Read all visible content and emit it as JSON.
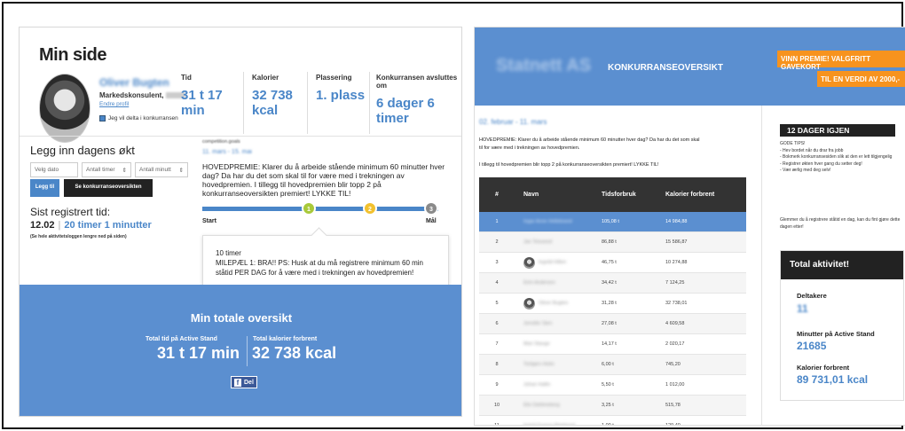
{
  "left": {
    "title": "Min side",
    "profile": {
      "name": "Oliver Bugten",
      "role": "Markedskonsulent,",
      "edit": "Endre profil",
      "join": "Jeg vil delta i konkurransen"
    },
    "stats": [
      {
        "label": "Tid",
        "value": "31 t 17 min"
      },
      {
        "label": "Kalorier",
        "value": "32 738 kcal"
      },
      {
        "label": "Plassering",
        "value": "1. plass"
      },
      {
        "label": "Konkurransen avsluttes om",
        "value": "6 dager 6 timer"
      }
    ],
    "log": {
      "title": "Legg inn dagens økt",
      "date_placeholder": "Velg dato",
      "hours_placeholder": "Antall timer",
      "minutes_placeholder": "Antall minutt",
      "add": "Legg til",
      "overview": "Se konkurranseoversikten"
    },
    "last": {
      "label": "Sist registrert tid:",
      "date": "12.02",
      "duration": "20 timer 1 minutter",
      "note": "(Se hele aktivitetsloggen lengre ned på siden)"
    },
    "competition": {
      "label": "competition.goals",
      "dates": "11. mars - 15. mai",
      "prize": "HOVEDPREMIE: Klarer du å arbeide stående minimum 60 minutter hver dag? Da har du det som skal til for være med i trekningen av hovedpremien. I tillegg til hovedpremien blir topp 2 på konkurranseoversikten premiert! LYKKE TIL!",
      "milestones": [
        "1",
        "2",
        "3"
      ],
      "start": "Start",
      "end": "Mål",
      "progress": 0.45
    },
    "tip": {
      "hours": "10 timer",
      "text": "MILEPÆL 1: BRA!! PS: Husk at du må registrere minimum 60 min ståtid PER DAG for å være med i trekningen av hovedpremien!"
    },
    "overview": {
      "title": "Min totale oversikt",
      "time_label": "Total tid på Active Stand",
      "time_value": "31 t 17 min",
      "kcal_label": "Total kalorier forbrent",
      "kcal_value": "32 738 kcal",
      "share": "Del"
    }
  },
  "right": {
    "logo": "Statnett AS",
    "heading": "KONKURRANSEOVERSIKT",
    "promo1": "VINN PREMIE! VALGFRITT GAVEKORT",
    "promo2": "TIL EN VERDI AV 2000,-",
    "dates": "02. februar - 11. mars",
    "prize": "HOVEDPREMIE: Klarer du å arbeide stående minimum 60 minutter hver dag? Da har du det som skal til for være med i trekningen av hovedpremien.",
    "bonus": "I tillegg til hovedpremien blir topp 2 på konkurranseoversikten premiert! LYKKE TIL!",
    "table": {
      "headers": [
        "#",
        "Navn",
        "Tidsforbruk",
        "Kalorier forbrent"
      ],
      "rows": [
        {
          "rank": "1",
          "name": "Ingar Anne Hellebrand",
          "time": "105,08 t",
          "kcal": "14 984,88"
        },
        {
          "rank": "2",
          "name": "Jan Teisseod",
          "time": "86,88 t",
          "kcal": "15 586,87"
        },
        {
          "rank": "3",
          "name": "Ingvild Hillen",
          "time": "46,75 t",
          "kcal": "10 274,88"
        },
        {
          "rank": "4",
          "name": "Eirin Andersen",
          "time": "34,42 t",
          "kcal": "7 124,25"
        },
        {
          "rank": "5",
          "name": "Oliver Bugten",
          "time": "31,28 t",
          "kcal": "32 738,01"
        },
        {
          "rank": "6",
          "name": "Jennifer Sten",
          "time": "27,08 t",
          "kcal": "4 609,58"
        },
        {
          "rank": "7",
          "name": "Mari Stange",
          "time": "14,17 t",
          "kcal": "2 020,17"
        },
        {
          "rank": "8",
          "name": "Torbjørn Holm",
          "time": "6,00 t",
          "kcal": "745,20"
        },
        {
          "rank": "9",
          "name": "Johan Hallin",
          "time": "5,50 t",
          "kcal": "1 012,00"
        },
        {
          "rank": "10",
          "name": "Elin Dahlmeberg",
          "time": "3,25 t",
          "kcal": "515,78"
        },
        {
          "rank": "11",
          "name": "Ingrid Gunvor Biørklund",
          "time": "1,00 t",
          "kcal": "129,40"
        }
      ]
    },
    "side": {
      "days": "12 DAGER IGJEN",
      "tips": [
        "GODE TIPS!",
        "- Hev bordet når du drar fra jobb",
        "- Bokmerk konkurransesiden slik at den er lett tilgjengelig",
        "- Registrer økten hver gang du setter deg!",
        "- Vær ærlig med deg selv!"
      ],
      "remind": "Glemmer du å registrere ståtid en dag, kan du fint gjøre dette dagen etter!",
      "total_title": "Total aktivitet!",
      "participants_label": "Deltakere",
      "participants_value": "11",
      "minutes_label": "Minutter på Active Stand",
      "minutes_value": "21685",
      "kcal_label": "Kalorier forbrent",
      "kcal_value": "89 731,01 kcal"
    }
  },
  "colors": {
    "accent": "#4a86c8",
    "banner": "#5b8fd0",
    "orange": "#f7931e",
    "green": "#a8c93a",
    "yellow": "#f2c12e",
    "gray": "#8a8a8a"
  }
}
